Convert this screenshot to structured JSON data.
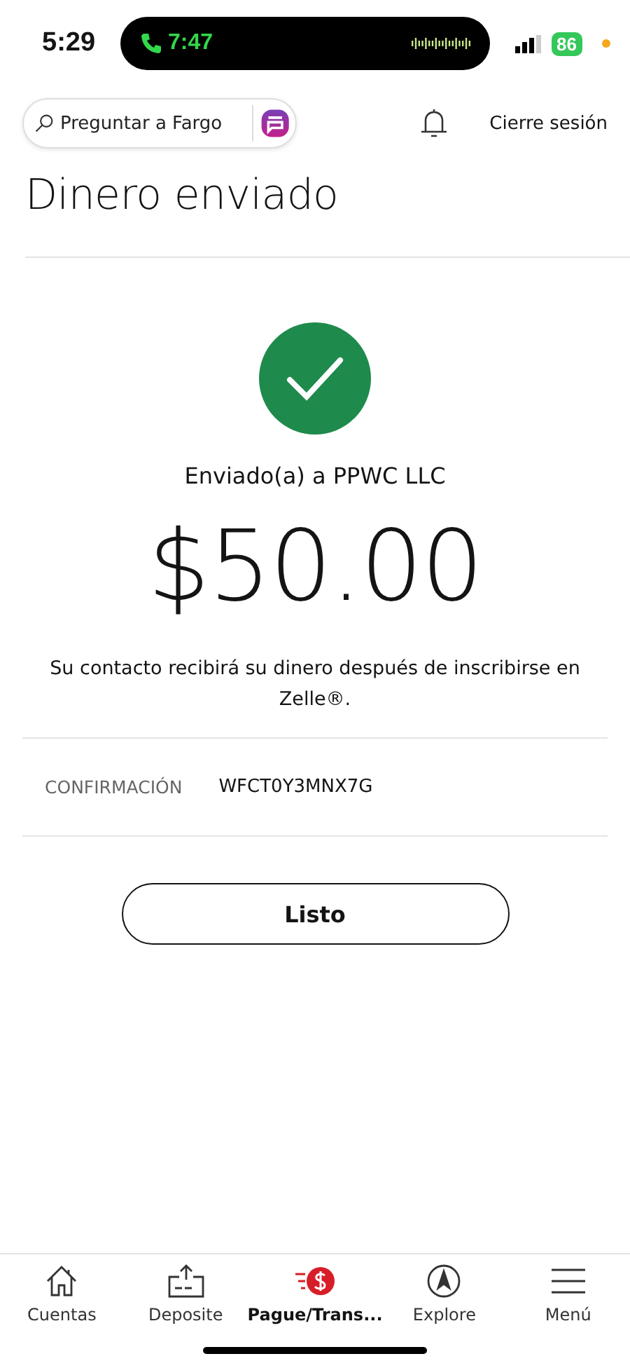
{
  "status_bar": {
    "time": "5:29",
    "call_time": "7:47",
    "battery": "86"
  },
  "header": {
    "search": {
      "placeholder": "Preguntar a Fargo"
    },
    "logout": "Cierre sesión"
  },
  "title": "Dinero enviado",
  "confirmation": {
    "recipient": "Enviado(a) a PPWC LLC",
    "amount": "$50.00",
    "message": "Su contacto recibirá su dinero después de inscribirse en Zelle®.",
    "label": "CONFIRMACIÓN",
    "code": "WFCT0Y3MNX7G"
  },
  "done_button": "Listo",
  "nav": [
    {
      "label": "Cuentas",
      "selected": false
    },
    {
      "label": "Deposite",
      "selected": false
    },
    {
      "label": "Pague/Trans...",
      "selected": true
    },
    {
      "label": "Explore",
      "selected": false
    },
    {
      "label": "Menú",
      "selected": false
    }
  ]
}
